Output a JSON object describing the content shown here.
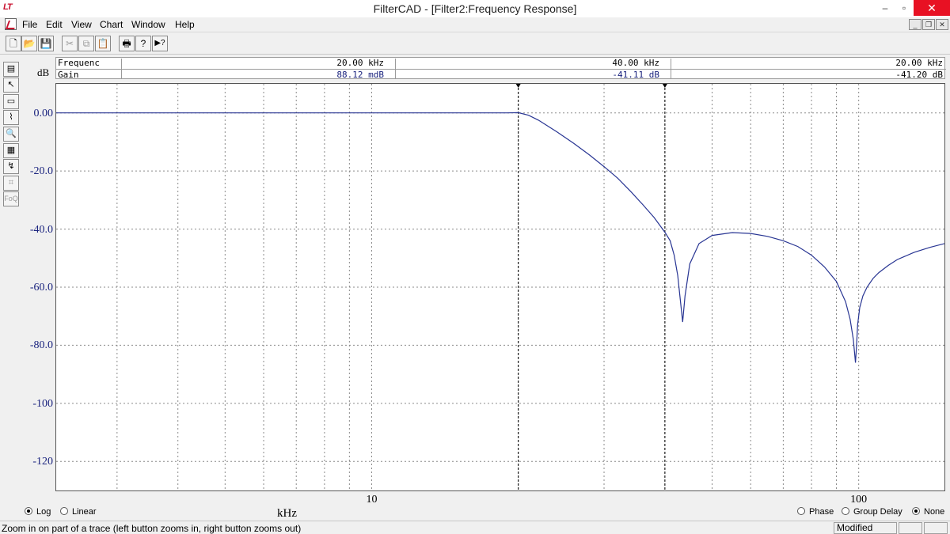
{
  "app": {
    "logo_text": "LT",
    "title": "FilterCAD - [Filter2:Frequency Response]",
    "window_buttons": {
      "minimize": "–",
      "restore": "▫",
      "close": "✕"
    }
  },
  "menu": {
    "items": [
      "File",
      "Edit",
      "View",
      "Chart",
      "Window",
      "Help"
    ],
    "mdi_buttons": {
      "minimize": "_",
      "restore": "❐",
      "close": "✕"
    }
  },
  "toolbar": {
    "buttons": [
      {
        "icon": "new-document-icon",
        "glyph": "🗋",
        "enabled": true
      },
      {
        "icon": "open-folder-icon",
        "glyph": "📂",
        "enabled": true
      },
      {
        "icon": "save-icon",
        "glyph": "💾",
        "enabled": true
      },
      {
        "icon": "cut-icon",
        "glyph": "✂",
        "enabled": false
      },
      {
        "icon": "copy-icon",
        "glyph": "⧉",
        "enabled": false
      },
      {
        "icon": "paste-icon",
        "glyph": "📋",
        "enabled": false
      },
      {
        "icon": "print-icon",
        "glyph": "🖶",
        "enabled": true
      },
      {
        "icon": "help-icon",
        "glyph": "?",
        "enabled": true
      },
      {
        "icon": "context-help-icon",
        "glyph": "▶?",
        "enabled": true
      }
    ]
  },
  "left_tools": [
    {
      "icon": "color-bars-icon",
      "glyph": "▤",
      "enabled": true
    },
    {
      "icon": "pointer-icon",
      "glyph": "↖",
      "enabled": true
    },
    {
      "icon": "frame-icon",
      "glyph": "▭",
      "enabled": true
    },
    {
      "icon": "zoom-trace-icon",
      "glyph": "⌇",
      "enabled": true
    },
    {
      "icon": "magnifier-icon",
      "glyph": "🔍",
      "enabled": false
    },
    {
      "icon": "report-icon",
      "glyph": "▦",
      "enabled": true
    },
    {
      "icon": "cursor-trace-icon",
      "glyph": "↯",
      "enabled": true
    },
    {
      "icon": "ruler-icon",
      "glyph": "⌗",
      "enabled": false
    },
    {
      "icon": "foq-icon",
      "glyph": "FoQ",
      "enabled": false
    }
  ],
  "readout": {
    "row1": {
      "label": "Frequenc",
      "values": [
        "20.00 kHz",
        "40.00 kHz",
        "20.00 kHz"
      ]
    },
    "row2": {
      "label": "Gain",
      "values": [
        "88.12 mdB",
        "-41.11 dB",
        "-41.20 dB"
      ]
    },
    "value_color": "#1a237e"
  },
  "y_unit": "dB",
  "x_unit": "kHz",
  "chart_data": {
    "type": "line",
    "x_scale": "log",
    "xlim": [
      2.25,
      150
    ],
    "ylim": [
      -130,
      10
    ],
    "y_ticks": [
      "0.00",
      "-20.0",
      "-40.0",
      "-60.0",
      "-80.0",
      "-100",
      "-120"
    ],
    "y_tick_values": [
      0,
      -20,
      -40,
      -60,
      -80,
      -100,
      -120
    ],
    "x_tick_labels": [
      "10",
      "100"
    ],
    "x_tick_values": [
      10,
      100
    ],
    "grid": true,
    "cursors_khz": [
      20,
      40
    ],
    "series": [
      {
        "color": "#283593",
        "x": [
          2.25,
          5,
          10,
          15,
          18,
          19,
          20,
          21,
          22,
          24,
          26,
          28,
          30,
          32,
          34,
          36,
          38,
          40,
          41,
          41.8,
          42.5,
          43.0,
          43.5,
          44,
          45,
          47,
          50,
          55,
          60,
          65,
          70,
          75,
          80,
          85,
          90,
          94,
          96,
          97.5,
          98.5,
          99.0,
          99.5,
          100.5,
          102,
          104,
          107,
          110,
          115,
          120,
          130,
          140,
          150
        ],
        "y": [
          0,
          0,
          0,
          0,
          0,
          0,
          0.09,
          -0.8,
          -2.5,
          -6.5,
          -10.5,
          -14.5,
          -18.5,
          -22.5,
          -27,
          -31.5,
          -36,
          -41.11,
          -44,
          -49,
          -56,
          -64,
          -72,
          -63,
          -52,
          -45,
          -42.2,
          -41.2,
          -41.5,
          -42.5,
          -44,
          -46,
          -49,
          -53,
          -58,
          -65,
          -71,
          -78,
          -86,
          -80,
          -73,
          -67,
          -63,
          -60,
          -57,
          -55,
          -52.5,
          -50.5,
          -48,
          -46.3,
          -45
        ]
      }
    ]
  },
  "scale_options": {
    "log": "Log",
    "linear": "Linear",
    "selected": "log"
  },
  "overlay_options": {
    "phase": "Phase",
    "group_delay": "Group Delay",
    "none": "None",
    "selected": "none"
  },
  "status": {
    "text": "Zoom in on part of a trace (left button zooms in, right button zooms out)",
    "pane1": "Modified",
    "pane2": "",
    "pane3": ""
  }
}
